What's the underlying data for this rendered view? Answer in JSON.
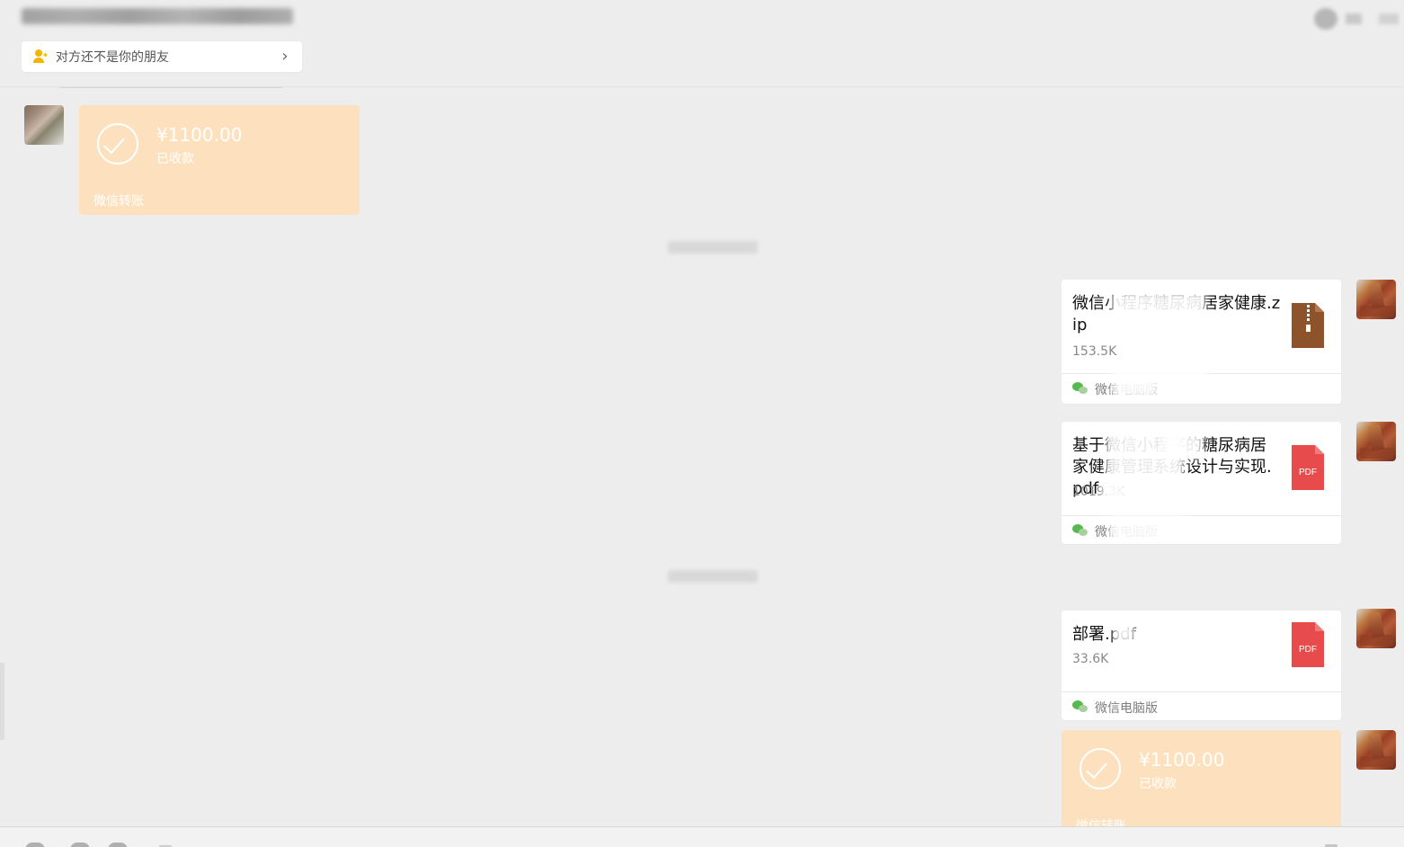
{
  "friend_notice": {
    "text": "对方还不是你的朋友",
    "icon": "person-warning-icon",
    "chevron": "›"
  },
  "transfers": [
    {
      "amount": "¥1100.00",
      "status": "已收款",
      "footer": "微信转账"
    },
    {
      "amount": "¥1100.00",
      "status": "已收款",
      "footer": "微信转账"
    }
  ],
  "files": [
    {
      "name": "微信小程序糖尿病居家健康.zip",
      "size": "153.5K",
      "icon": "zip-file-icon",
      "source": "微信电脑版"
    },
    {
      "name": "基于微信小程序的糖尿病居家健康管理系统设计与实现.pdf",
      "size": "1019.3K",
      "icon": "pdf-file-icon",
      "icon_label": "PDF",
      "source": "微信电脑版"
    },
    {
      "name": "部署.pdf",
      "size": "33.6K",
      "icon": "pdf-file-icon",
      "icon_label": "PDF",
      "source": "微信电脑版"
    }
  ],
  "colors": {
    "background": "#ededed",
    "transfer_card": "#fde1be",
    "file_card": "#ffffff",
    "pdf_red": "#e84b4b",
    "zip_brown": "#8d542c",
    "wechat_green": "#56b94d"
  }
}
